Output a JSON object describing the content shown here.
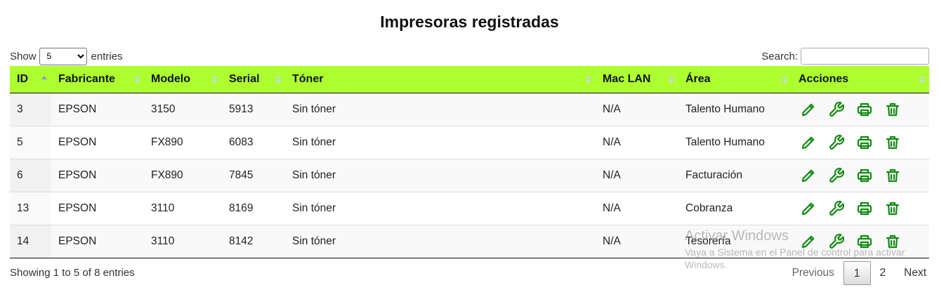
{
  "title": "Impresoras registradas",
  "length": {
    "show_label": "Show",
    "selected": "5",
    "entries_label": "entries"
  },
  "search": {
    "label": "Search:",
    "value": ""
  },
  "columns": [
    "ID",
    "Fabricante",
    "Modelo",
    "Serial",
    "Tóner",
    "Mac LAN",
    "Área",
    "Acciones"
  ],
  "sorted_column": "ID",
  "rows": [
    {
      "id": "3",
      "fabricante": "EPSON",
      "modelo": "3150",
      "serial": "5913",
      "toner": "Sin tóner",
      "mac": "N/A",
      "area": "Talento Humano"
    },
    {
      "id": "5",
      "fabricante": "EPSON",
      "modelo": "FX890",
      "serial": "6083",
      "toner": "Sin tóner",
      "mac": "N/A",
      "area": "Talento Humano"
    },
    {
      "id": "6",
      "fabricante": "EPSON",
      "modelo": "FX890",
      "serial": "7845",
      "toner": "Sin tóner",
      "mac": "N/A",
      "area": "Facturación"
    },
    {
      "id": "13",
      "fabricante": "EPSON",
      "modelo": "3110",
      "serial": "8169",
      "toner": "Sin tóner",
      "mac": "N/A",
      "area": "Cobranza"
    },
    {
      "id": "14",
      "fabricante": "EPSON",
      "modelo": "3110",
      "serial": "8142",
      "toner": "Sin tóner",
      "mac": "N/A",
      "area": "Tesorería"
    }
  ],
  "actions": [
    "edit-icon",
    "wrench-icon",
    "printer-icon",
    "trash-icon"
  ],
  "info": "Showing 1 to 5 of 8 entries",
  "pagination": {
    "previous": "Previous",
    "pages": [
      "1",
      "2"
    ],
    "current": "1",
    "next": "Next"
  },
  "watermark": {
    "line1": "Activar Windows",
    "line2": "Vaya a Sistema en el Panel de control para activar Windows."
  },
  "colors": {
    "header_bg": "#adff2f",
    "action_icon": "#118a11"
  }
}
